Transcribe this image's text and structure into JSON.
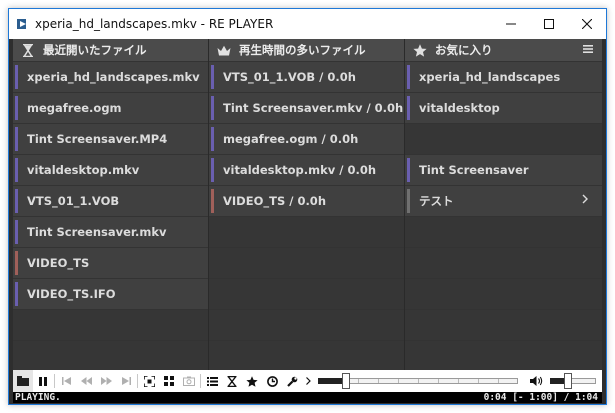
{
  "window": {
    "title": "xperia_hd_landscapes.mkv - RE PLAYER"
  },
  "columns": [
    {
      "title": "最近開いたファイル",
      "icon": "hourglass-icon",
      "rows": [
        {
          "label": "xperia_hd_landscapes.mkv",
          "marker": "purple"
        },
        {
          "label": "megafree.ogm",
          "marker": "purple"
        },
        {
          "label": "Tint Screensaver.MP4",
          "marker": "purple"
        },
        {
          "label": "vitaldesktop.mkv",
          "marker": "purple"
        },
        {
          "label": "VTS_01_1.VOB",
          "marker": "purple"
        },
        {
          "label": "Tint Screensaver.mkv",
          "marker": "purple"
        },
        {
          "label": "VIDEO_TS",
          "marker": "red"
        },
        {
          "label": "VIDEO_TS.IFO",
          "marker": "purple"
        }
      ]
    },
    {
      "title": "再生時間の多いファイル",
      "icon": "crown-icon",
      "rows": [
        {
          "label": "VTS_01_1.VOB  /  0.0h",
          "marker": "purple"
        },
        {
          "label": "Tint Screensaver.mkv  /  0.0h",
          "marker": "purple"
        },
        {
          "label": "megafree.ogm  /  0.0h",
          "marker": "purple"
        },
        {
          "label": "vitaldesktop.mkv  /  0.0h",
          "marker": "purple"
        },
        {
          "label": "VIDEO_TS  /  0.0h",
          "marker": "red"
        }
      ]
    },
    {
      "title": "お気に入り",
      "icon": "star-icon",
      "rows": [
        {
          "label": "xperia_hd_landscapes",
          "marker": "purple"
        },
        {
          "label": "vitaldesktop",
          "marker": "purple"
        },
        {
          "label": "",
          "marker": "none"
        },
        {
          "label": "Tint Screensaver",
          "marker": "purple"
        },
        {
          "label": "テスト",
          "marker": "gray",
          "chevron": true
        }
      ]
    }
  ],
  "toolbar": {
    "buttons": [
      "playlist-icon",
      "pause-icon",
      "skip-start-icon",
      "rewind-icon",
      "fast-forward-icon",
      "skip-end-icon",
      "fullscreen-icon",
      "grid-icon",
      "camera-icon",
      "list-icon",
      "hourglass-icon",
      "star-icon",
      "clock-icon",
      "wrench-icon",
      "chevron-right-icon"
    ],
    "seek_progress": 0.12,
    "volume_level": 0.3
  },
  "status": {
    "state": "PLAYING.",
    "time": "0:04 [- 1:00] / 1:04"
  },
  "colors": {
    "marker_purple": "#6a5fb0",
    "marker_red": "#a0605a",
    "marker_gray": "#707070",
    "header_bg": "#4b4b4b",
    "row_bg": "#404040"
  }
}
